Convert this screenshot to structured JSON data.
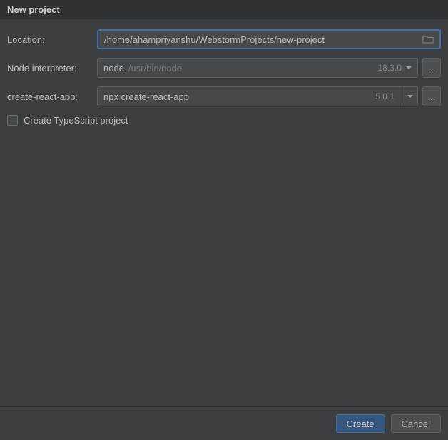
{
  "title": "New project",
  "form": {
    "location": {
      "label": "Location:",
      "value": "/home/ahampriyanshu/WebstormProjects/new-project"
    },
    "interpreter": {
      "label": "Node interpreter:",
      "value": "node",
      "hint": "/usr/bin/node",
      "version": "18.3.0",
      "ellipsis": "..."
    },
    "cra": {
      "label": "create-react-app:",
      "value": "npx create-react-app",
      "version": "5.0.1",
      "ellipsis": "..."
    },
    "typescript": {
      "label": "Create TypeScript project"
    }
  },
  "footer": {
    "create": "Create",
    "cancel": "Cancel"
  }
}
